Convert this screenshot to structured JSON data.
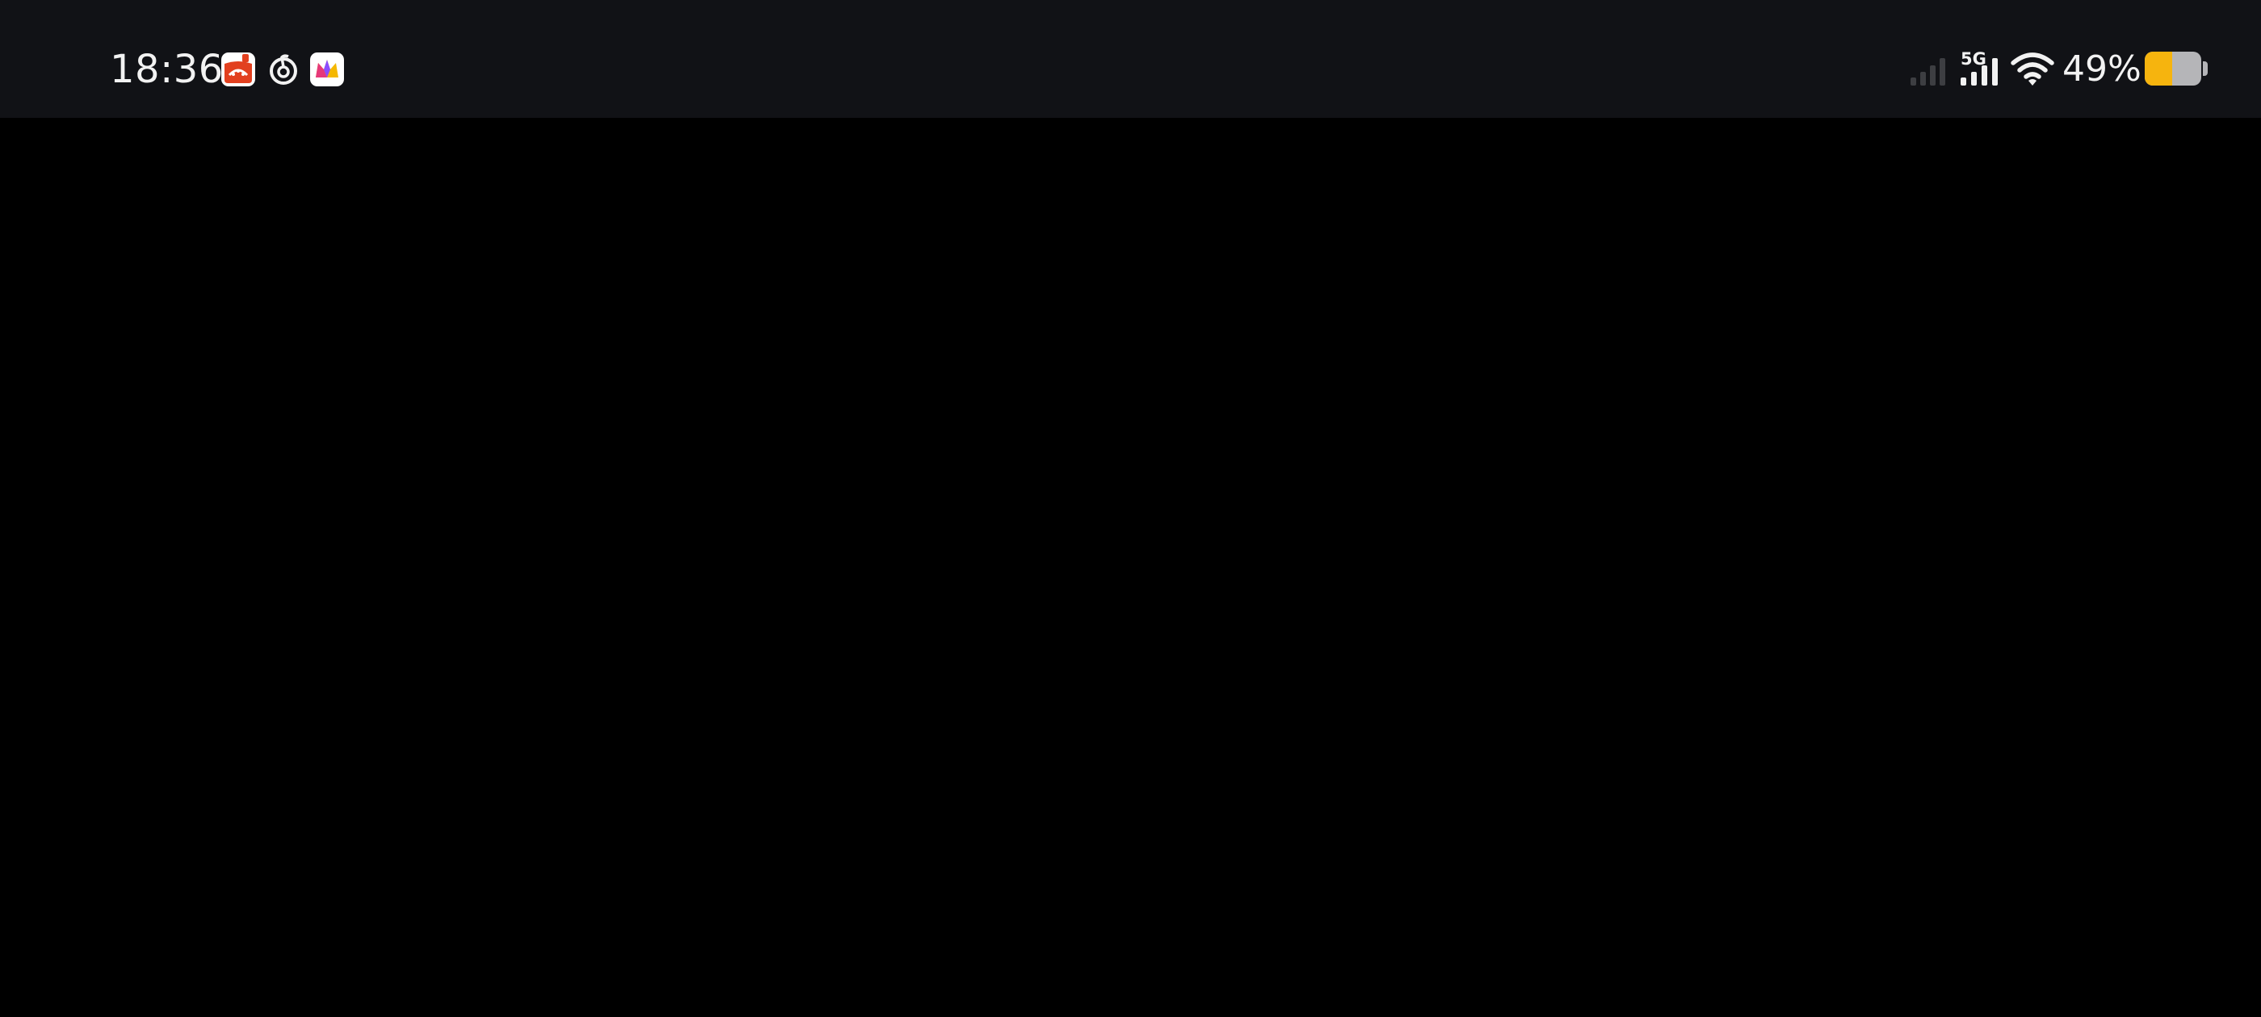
{
  "status_bar": {
    "time": "18:36",
    "notification_icons": [
      "shopping-bag-app-icon",
      "netease-music-app-icon",
      "crown-app-icon"
    ],
    "network_type": "5G",
    "sim1_signal": "signal-empty-icon",
    "sim2_signal": "signal-full-icon",
    "wifi": "wifi-icon",
    "battery_percent_label": "49%",
    "battery_level": 0.49
  },
  "colors": {
    "status_bar_bg": "#111216",
    "screen_bg": "#000000",
    "text": "#f2f2f2",
    "battery_fill": "#f6b40e",
    "battery_track": "#b5b5b8"
  }
}
